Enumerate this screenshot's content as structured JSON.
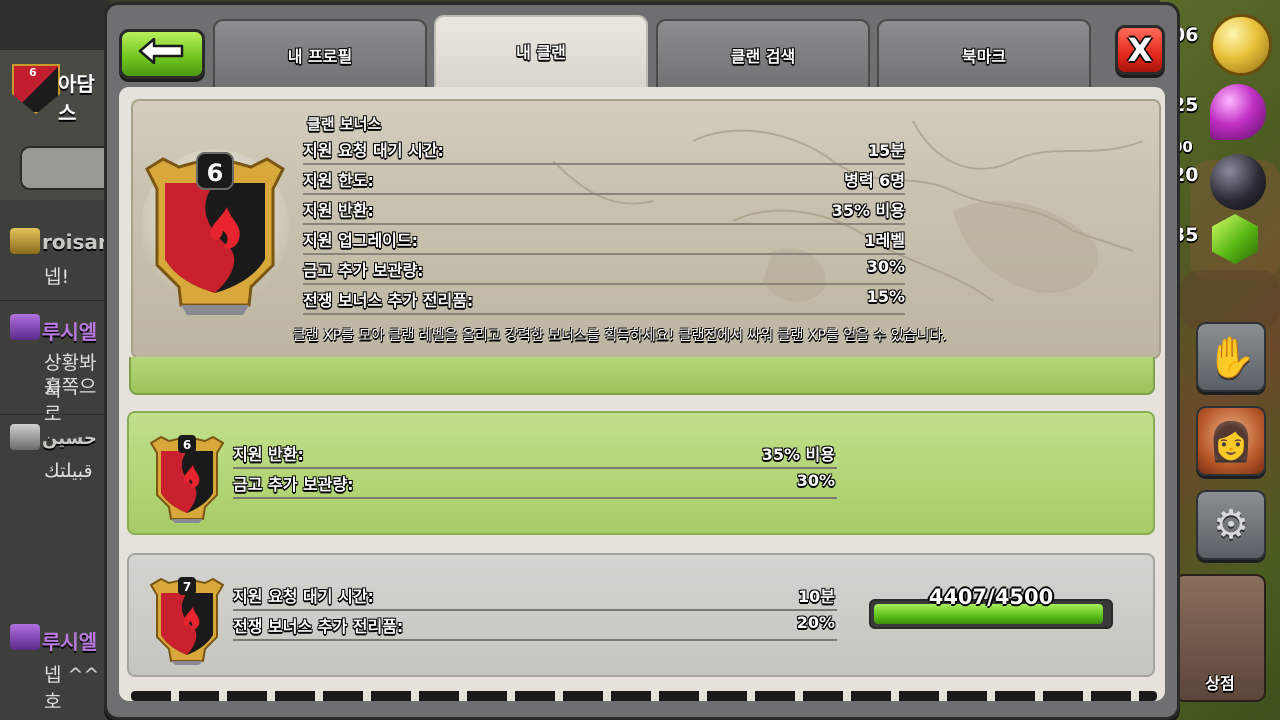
{
  "resources": {
    "gold": "06",
    "elixir": "25",
    "dark_elixir_top": "00",
    "dark_elixir": "20",
    "gems": "35"
  },
  "chat": {
    "clan_level": "6",
    "clan_name": "아담스",
    "messages": [
      {
        "user": "roisar",
        "text": "넵!",
        "rank": "gold"
      },
      {
        "user": "루시엘",
        "text": "상황봐서",
        "text2": "흘쪽으로",
        "rank": "purple"
      },
      {
        "user": "حسين",
        "text": "قبيلتك",
        "rank": "silver"
      },
      {
        "user": "루시엘",
        "text": "넵 ^^호",
        "rank": "purple"
      }
    ]
  },
  "shop_label": "상점",
  "tabs": [
    {
      "label": "내 프로필",
      "active": false
    },
    {
      "label": "내 클랜",
      "active": true
    },
    {
      "label": "클랜 검색",
      "active": false
    },
    {
      "label": "북마크",
      "active": false
    }
  ],
  "bonus": {
    "title": "클랜 보너스",
    "level": "6",
    "rows": [
      {
        "label": "지원 요청 대기 시간:",
        "value": "15분"
      },
      {
        "label": "지원 한도:",
        "value": "병력 6명"
      },
      {
        "label": "지원 반환:",
        "value": "35% 비용"
      },
      {
        "label": "지원 업그레이드:",
        "value": "1레벨"
      },
      {
        "label": "금고 추가 보관량:",
        "value": "30%"
      },
      {
        "label": "전쟁 보너스 추가 전리품:",
        "value": "15%"
      }
    ],
    "note": "클랜 XP를 모아 클랜 레벨을 올리고 강력한 보너스를 획득하세요! 클랜전에서 싸워 클랜 XP를 얻을 수 있습니다."
  },
  "current_level": {
    "level": "6",
    "rows": [
      {
        "label": "지원 반환:",
        "value": "35% 비용"
      },
      {
        "label": "금고 추가 보관량:",
        "value": "30%"
      }
    ]
  },
  "next_level": {
    "level": "7",
    "rows": [
      {
        "label": "지원 요청 대기 시간:",
        "value": "10분"
      },
      {
        "label": "전쟁 보너스 추가 전리품:",
        "value": "20%"
      }
    ],
    "xp_text": "4407/4500",
    "xp_progress": 0.979
  },
  "colors": {
    "badge_red": "#c8202c",
    "badge_black": "#1a1a1a",
    "badge_gold": "#d9a83a",
    "accent_green": "#7cc42a",
    "close_red": "#e52a1e"
  }
}
